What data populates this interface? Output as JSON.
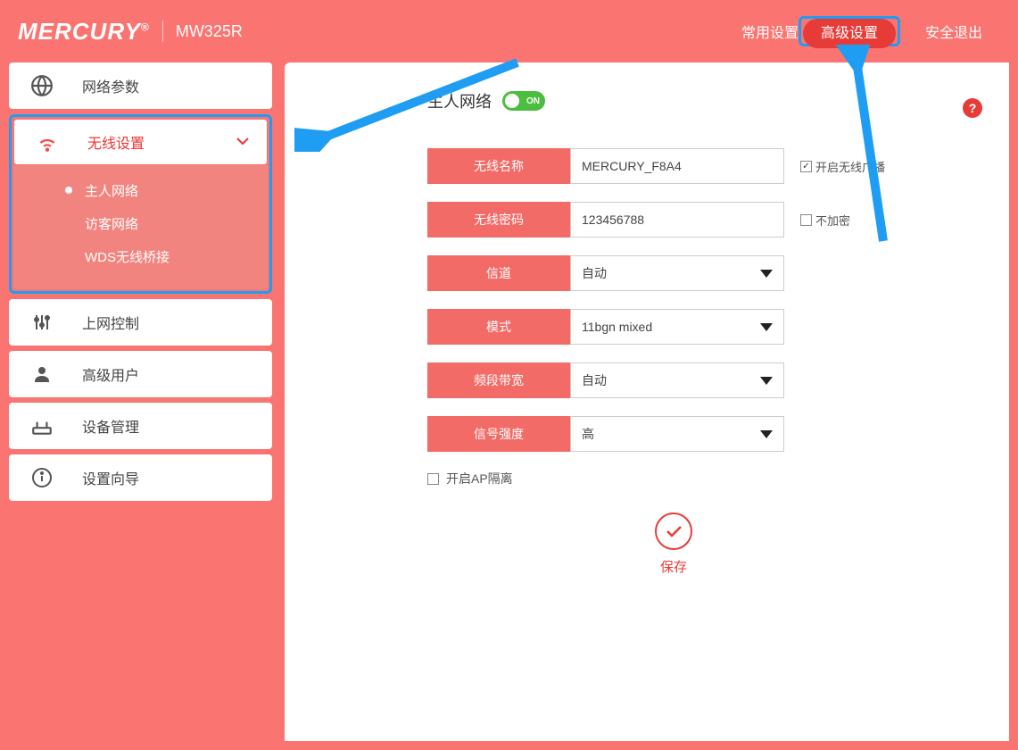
{
  "header": {
    "brand": "MERCURY",
    "brand_sup": "®",
    "model": "MW325R",
    "nav_basic": "常用设置",
    "nav_advanced": "高级设置",
    "nav_logout": "安全退出"
  },
  "sidebar": {
    "network": "网络参数",
    "wireless": "无线设置",
    "sub_owner": "主人网络",
    "sub_guest": "访客网络",
    "sub_wds": "WDS无线桥接",
    "access_ctrl": "上网控制",
    "adv_user": "高级用户",
    "device_mgmt": "设备管理",
    "setup_wizard": "设置向导"
  },
  "page": {
    "title": "主人网络",
    "toggle_text": "ON",
    "help_icon": "?",
    "form": {
      "ssid_label": "无线名称",
      "ssid_value": "MERCURY_F8A4",
      "broadcast_label": "开启无线广播",
      "broadcast_checked": true,
      "pwd_label": "无线密码",
      "pwd_value": "123456788",
      "no_encrypt_label": "不加密",
      "no_encrypt_checked": false,
      "channel_label": "信道",
      "channel_value": "自动",
      "mode_label": "模式",
      "mode_value": "11bgn mixed",
      "bandwidth_label": "频段带宽",
      "bandwidth_value": "自动",
      "signal_label": "信号强度",
      "signal_value": "高",
      "ap_isolation_label": "开启AP隔离",
      "ap_isolation_checked": false
    },
    "save_label": "保存"
  }
}
